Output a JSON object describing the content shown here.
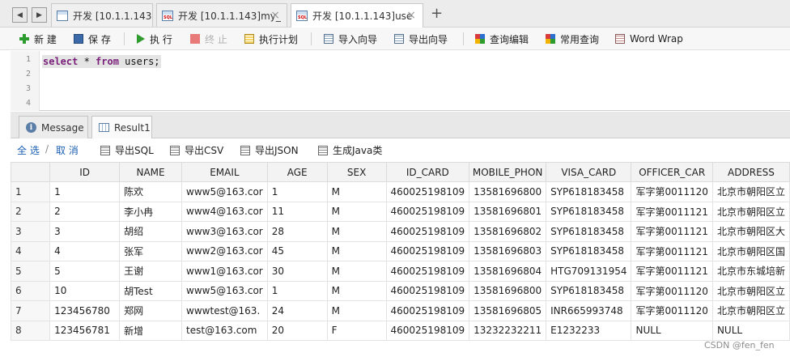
{
  "tabs": [
    {
      "label": "开发 [10.1.1.143]",
      "icon": "table-icon",
      "closable": false,
      "active": false
    },
    {
      "label": "开发 [10.1.1.143]my_",
      "icon": "sql-file-icon",
      "closable": true,
      "active": false
    },
    {
      "label": "开发 [10.1.1.143]use",
      "icon": "sql-file-icon",
      "closable": true,
      "active": true
    }
  ],
  "tab_add": "+",
  "toolbar": {
    "new": "新 建",
    "save": "保 存",
    "run": "执 行",
    "stop": "终 止",
    "plan": "执行计划",
    "import": "导入向导",
    "export": "导出向导",
    "query_edit": "查询编辑",
    "common_query": "常用查询",
    "word_wrap": "Word Wrap"
  },
  "editor": {
    "line_numbers": [
      "1",
      "2",
      "3",
      "4"
    ],
    "tokens": {
      "kw1": "select",
      "star": " * ",
      "kw2": "from",
      "rest": " users;"
    }
  },
  "result_tabs": {
    "message": "Message",
    "result": "Result1"
  },
  "result_actions": {
    "select_all": "全 选",
    "slash": "/",
    "cancel": "取 消",
    "export_sql": "导出SQL",
    "export_csv": "导出CSV",
    "export_json": "导出JSON",
    "gen_java": "生成Java类"
  },
  "grid": {
    "columns": [
      "",
      "ID",
      "NAME",
      "EMAIL",
      "AGE",
      "SEX",
      "ID_CARD",
      "MOBILE_PHON",
      "VISA_CARD",
      "OFFICER_CAR",
      "ADDRESS"
    ],
    "rows": [
      [
        "1",
        "1",
        "陈欢",
        "www5@163.cor",
        "1",
        "M",
        "460025198109",
        "13581696800",
        "SYP618183458",
        "军字第0011120",
        "北京市朝阳区立"
      ],
      [
        "2",
        "2",
        "李小冉",
        "www4@163.cor",
        "11",
        "M",
        "460025198109",
        "13581696801",
        "SYP618183458",
        "军字第0011121",
        "北京市朝阳区立"
      ],
      [
        "3",
        "3",
        "胡绍",
        "www3@163.cor",
        "28",
        "M",
        "460025198109",
        "13581696802",
        "SYP618183458",
        "军字第0011121",
        "北京市朝阳区大"
      ],
      [
        "4",
        "4",
        "张军",
        "www2@163.cor",
        "45",
        "M",
        "460025198109",
        "13581696803",
        "SYP618183458",
        "军字第0011121",
        "北京市朝阳区国"
      ],
      [
        "5",
        "5",
        "王谢",
        "www1@163.cor",
        "30",
        "M",
        "460025198109",
        "13581696804",
        "HTG709131954",
        "军字第0011121",
        "北京市东城培新"
      ],
      [
        "6",
        "10",
        "胡Test",
        "www5@163.cor",
        "1",
        "M",
        "460025198109",
        "13581696800",
        "SYP618183458",
        "军字第0011120",
        "北京市朝阳区立"
      ],
      [
        "7",
        "123456780",
        "郑网",
        "wwwtest@163.",
        "24",
        "M",
        "460025198109",
        "13581696805",
        "INR665993748",
        "军字第0011120",
        "北京市朝阳区立"
      ],
      [
        "8",
        "123456781",
        "新增",
        "test@163.com",
        "20",
        "F",
        "460025198109",
        "13232232211",
        "E1232233",
        "NULL",
        "NULL"
      ]
    ]
  },
  "watermark": "CSDN @fen_fen",
  "colors": {
    "accent_link": "#1a5fb4",
    "keyword": "#7a1f7a",
    "run_icon": "#2e9b2e",
    "new_icon": "#2e9b2e",
    "stop_icon": "#e05a5a"
  }
}
